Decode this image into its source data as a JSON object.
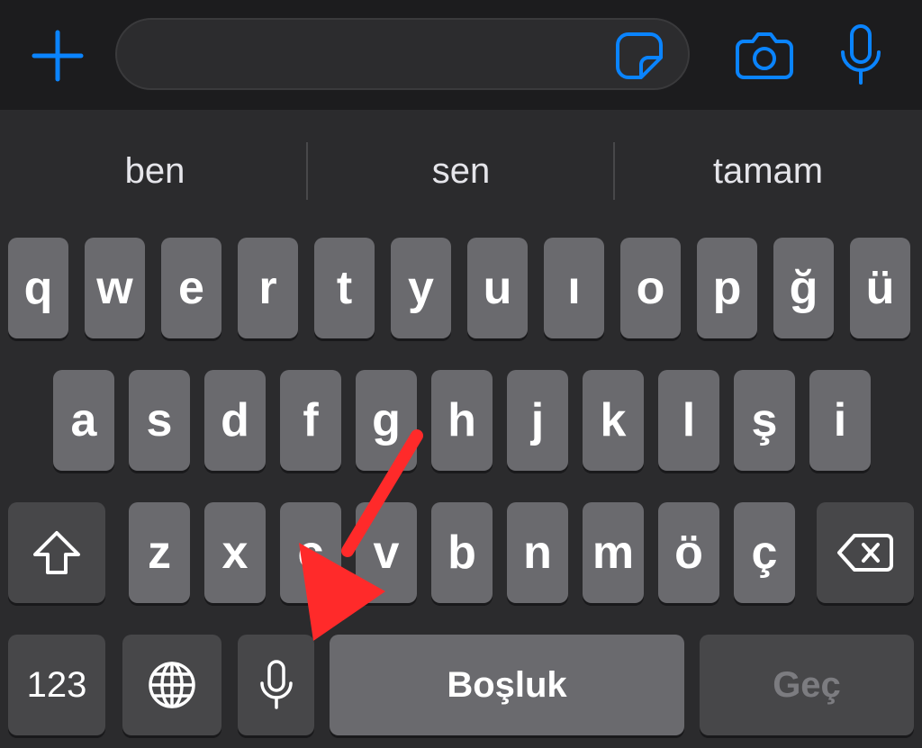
{
  "input_bar": {
    "message_value": "",
    "icons": {
      "plus": "plus-icon",
      "sticker": "sticker-icon",
      "camera": "camera-icon",
      "mic": "microphone-icon"
    },
    "accent_color": "#0a84ff"
  },
  "suggestions": [
    "ben",
    "sen",
    "tamam"
  ],
  "keyboard": {
    "row1": [
      "q",
      "w",
      "e",
      "r",
      "t",
      "y",
      "u",
      "ı",
      "o",
      "p",
      "ğ",
      "ü"
    ],
    "row2": [
      "a",
      "s",
      "d",
      "f",
      "g",
      "h",
      "j",
      "k",
      "l",
      "ş",
      "i"
    ],
    "row3": [
      "z",
      "x",
      "c",
      "v",
      "b",
      "n",
      "m",
      "ö",
      "ç"
    ],
    "numbers_label": "123",
    "space_label": "Boşluk",
    "go_label": "Geç",
    "icons": {
      "shift": "shift-icon",
      "backspace": "backspace-icon",
      "globe": "globe-icon",
      "dictation": "microphone-icon"
    }
  },
  "annotation": {
    "type": "arrow",
    "color": "#ff2a2a",
    "points_to": "dictation-key"
  }
}
